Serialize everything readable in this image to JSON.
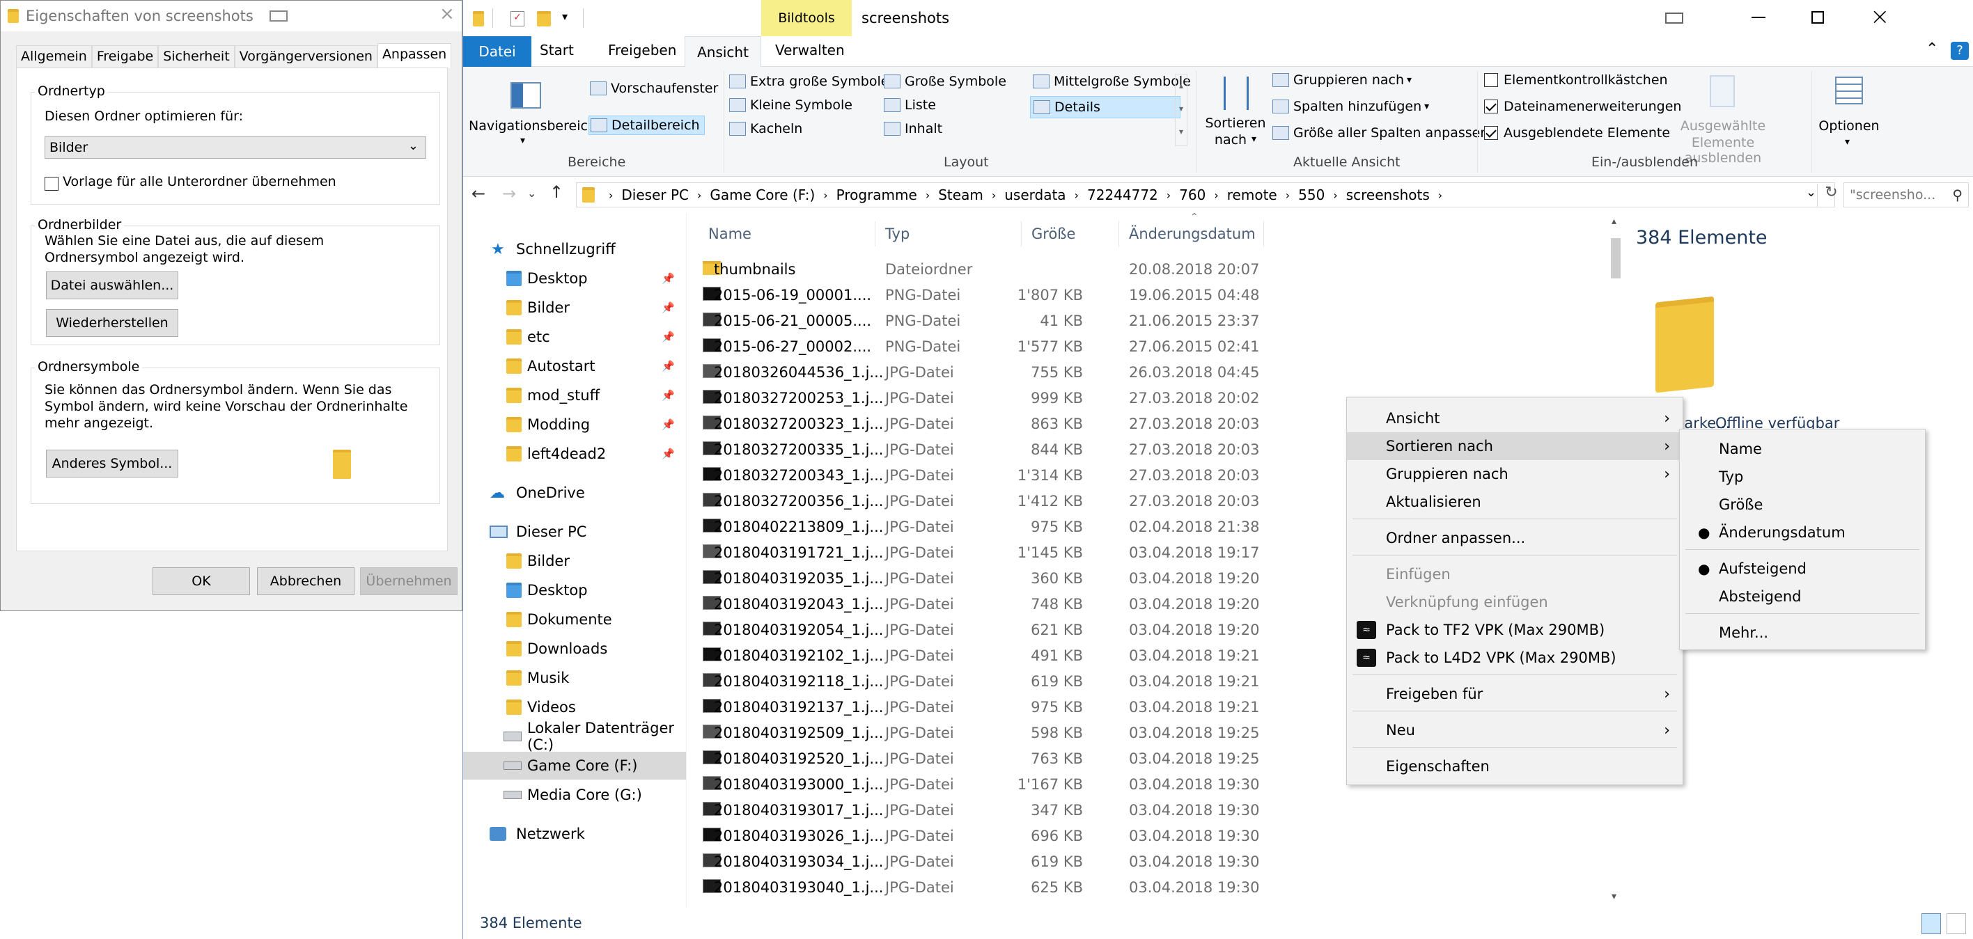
{
  "props_dialog": {
    "title": "Eigenschaften von screenshots",
    "tabs": [
      "Allgemein",
      "Freigabe",
      "Sicherheit",
      "Vorgängerversionen",
      "Anpassen"
    ],
    "ordnertyp": {
      "title": "Ordnertyp",
      "optimize_label": "Diesen Ordner optimieren für:",
      "select_value": "Bilder",
      "template_checkbox": "Vorlage für alle Unterordner übernehmen"
    },
    "ordnerbilder": {
      "title": "Ordnerbilder",
      "desc": "Wählen Sie eine Datei aus, die auf diesem Ordnersymbol angezeigt wird.",
      "choose_button": "Datei auswählen...",
      "restore_button": "Wiederherstellen"
    },
    "ordnersymbole": {
      "title": "Ordnersymbole",
      "desc": "Sie können das Ordnersymbol ändern. Wenn Sie das Symbol ändern, wird keine Vorschau der Ordnerinhalte mehr angezeigt.",
      "other_icon_button": "Anderes Symbol..."
    },
    "buttons": {
      "ok": "OK",
      "cancel": "Abbrechen",
      "apply": "Übernehmen"
    }
  },
  "explorer": {
    "context_tab_label": "Bildtools",
    "window_title": "screenshots",
    "ribbon_tabs": [
      "Datei",
      "Start",
      "Freigeben",
      "Ansicht",
      "Verwalten"
    ],
    "ribbon": {
      "bereiche": {
        "title": "Bereiche",
        "nav_pane": "Navigationsbereich",
        "preview": "Vorschaufenster",
        "details": "Detailbereich"
      },
      "layout": {
        "title": "Layout",
        "items": [
          "Extra große Symbole",
          "Große Symbole",
          "Mittelgroße Symbole",
          "Kleine Symbole",
          "Liste",
          "Details",
          "Kacheln",
          "Inhalt"
        ]
      },
      "aktuelle_ansicht": {
        "title": "Aktuelle Ansicht",
        "sort_by_line1": "Sortieren",
        "sort_by_line2": "nach",
        "group_by": "Gruppieren nach",
        "add_columns": "Spalten hinzufügen",
        "fit_columns": "Größe aller Spalten anpassen"
      },
      "ein_ausblenden": {
        "title": "Ein-/ausblenden",
        "checkbox_items": "Elementkontrollkästchen",
        "file_extensions": "Dateinamenerweiterungen",
        "hidden_items": "Ausgeblendete Elemente",
        "hide_selected_line1": "Ausgewählte",
        "hide_selected_line2": "Elemente ausblenden"
      },
      "options": "Optionen"
    },
    "breadcrumb": [
      "Dieser PC",
      "Game Core (F:)",
      "Programme",
      "Steam",
      "userdata",
      "72244772",
      "760",
      "remote",
      "550",
      "screenshots"
    ],
    "search_placeholder": "\"screensho...",
    "columns": [
      "Name",
      "Typ",
      "Größe",
      "Änderungsdatum"
    ],
    "nav": {
      "quick_access": "Schnellzugriff",
      "quick_items": [
        "Desktop",
        "Bilder",
        "etc",
        "Autostart",
        "mod_stuff",
        "Modding",
        "left4dead2"
      ],
      "onedrive": "OneDrive",
      "this_pc": "Dieser PC",
      "pc_items": [
        "Bilder",
        "Desktop",
        "Dokumente",
        "Downloads",
        "Musik",
        "Videos",
        "Lokaler Datenträger (C:)",
        "Game Core (F:)",
        "Media Core (G:)"
      ],
      "network": "Netzwerk"
    },
    "files": [
      {
        "name": "thumbnails",
        "type": "Dateiordner",
        "size": "",
        "date": "20.08.2018 20:07",
        "kind": "folder"
      },
      {
        "name": "2015-06-19_00001....",
        "type": "PNG-Datei",
        "size": "1'807 KB",
        "date": "19.06.2015 04:48",
        "kind": "img"
      },
      {
        "name": "2015-06-21_00005....",
        "type": "PNG-Datei",
        "size": "41 KB",
        "date": "21.06.2015 23:37",
        "kind": "img"
      },
      {
        "name": "2015-06-27_00002....",
        "type": "PNG-Datei",
        "size": "1'577 KB",
        "date": "27.06.2015 02:41",
        "kind": "img"
      },
      {
        "name": "20180326044536_1.j...",
        "type": "JPG-Datei",
        "size": "755 KB",
        "date": "26.03.2018 04:45",
        "kind": "img"
      },
      {
        "name": "20180327200253_1.j...",
        "type": "JPG-Datei",
        "size": "999 KB",
        "date": "27.03.2018 20:02",
        "kind": "img"
      },
      {
        "name": "20180327200323_1.j...",
        "type": "JPG-Datei",
        "size": "863 KB",
        "date": "27.03.2018 20:03",
        "kind": "img"
      },
      {
        "name": "20180327200335_1.j...",
        "type": "JPG-Datei",
        "size": "844 KB",
        "date": "27.03.2018 20:03",
        "kind": "img"
      },
      {
        "name": "20180327200343_1.j...",
        "type": "JPG-Datei",
        "size": "1'314 KB",
        "date": "27.03.2018 20:03",
        "kind": "img"
      },
      {
        "name": "20180327200356_1.j...",
        "type": "JPG-Datei",
        "size": "1'412 KB",
        "date": "27.03.2018 20:03",
        "kind": "img"
      },
      {
        "name": "20180402213809_1.j...",
        "type": "JPG-Datei",
        "size": "975 KB",
        "date": "02.04.2018 21:38",
        "kind": "img"
      },
      {
        "name": "20180403191721_1.j...",
        "type": "JPG-Datei",
        "size": "1'145 KB",
        "date": "03.04.2018 19:17",
        "kind": "img"
      },
      {
        "name": "20180403192035_1.j...",
        "type": "JPG-Datei",
        "size": "360 KB",
        "date": "03.04.2018 19:20",
        "kind": "img"
      },
      {
        "name": "20180403192043_1.j...",
        "type": "JPG-Datei",
        "size": "748 KB",
        "date": "03.04.2018 19:20",
        "kind": "img"
      },
      {
        "name": "20180403192054_1.j...",
        "type": "JPG-Datei",
        "size": "621 KB",
        "date": "03.04.2018 19:20",
        "kind": "img"
      },
      {
        "name": "20180403192102_1.j...",
        "type": "JPG-Datei",
        "size": "491 KB",
        "date": "03.04.2018 19:21",
        "kind": "img"
      },
      {
        "name": "20180403192118_1.j...",
        "type": "JPG-Datei",
        "size": "619 KB",
        "date": "03.04.2018 19:21",
        "kind": "img"
      },
      {
        "name": "20180403192137_1.j...",
        "type": "JPG-Datei",
        "size": "975 KB",
        "date": "03.04.2018 19:21",
        "kind": "img"
      },
      {
        "name": "20180403192509_1.j...",
        "type": "JPG-Datei",
        "size": "598 KB",
        "date": "03.04.2018 19:25",
        "kind": "img"
      },
      {
        "name": "20180403192520_1.j...",
        "type": "JPG-Datei",
        "size": "763 KB",
        "date": "03.04.2018 19:25",
        "kind": "img"
      },
      {
        "name": "20180403193000_1.j...",
        "type": "JPG-Datei",
        "size": "1'167 KB",
        "date": "03.04.2018 19:30",
        "kind": "img"
      },
      {
        "name": "20180403193017_1.j...",
        "type": "JPG-Datei",
        "size": "347 KB",
        "date": "03.04.2018 19:30",
        "kind": "img"
      },
      {
        "name": "20180403193026_1.j...",
        "type": "JPG-Datei",
        "size": "696 KB",
        "date": "03.04.2018 19:30",
        "kind": "img"
      },
      {
        "name": "20180403193034_1.j...",
        "type": "JPG-Datei",
        "size": "619 KB",
        "date": "03.04.2018 19:30",
        "kind": "img"
      },
      {
        "name": "20180403193040_1.j...",
        "type": "JPG-Datei",
        "size": "625 KB",
        "date": "03.04.2018 19:30",
        "kind": "img"
      }
    ],
    "details_pane": {
      "count": "384 Elemente",
      "offline_left": "...fügbarke...",
      "offline_right": "Offline verfügbar"
    },
    "status_bar": "384 Elemente"
  },
  "context_menu": {
    "items": [
      {
        "label": "Ansicht",
        "submenu": true,
        "disabled": false
      },
      {
        "label": "Sortieren nach",
        "submenu": true,
        "disabled": false
      },
      {
        "label": "Gruppieren nach",
        "submenu": true,
        "disabled": false
      },
      {
        "label": "Aktualisieren",
        "submenu": false,
        "disabled": false
      },
      {
        "label": "Ordner anpassen...",
        "submenu": false,
        "disabled": false
      },
      {
        "label": "Einfügen",
        "submenu": false,
        "disabled": true
      },
      {
        "label": "Verknüpfung einfügen",
        "submenu": false,
        "disabled": true
      },
      {
        "label": "Pack to TF2 VPK (Max 290MB)",
        "submenu": false,
        "disabled": false
      },
      {
        "label": "Pack to L4D2 VPK (Max 290MB)",
        "submenu": false,
        "disabled": false
      },
      {
        "label": "Freigeben für",
        "submenu": true,
        "disabled": false
      },
      {
        "label": "Neu",
        "submenu": true,
        "disabled": false
      },
      {
        "label": "Eigenschaften",
        "submenu": false,
        "disabled": false
      }
    ],
    "sort_submenu": {
      "fields": [
        "Name",
        "Typ",
        "Größe",
        "Änderungsdatum"
      ],
      "selected_field": "Änderungsdatum",
      "orders": [
        "Aufsteigend",
        "Absteigend"
      ],
      "selected_order": "Aufsteigend",
      "more": "Mehr..."
    }
  },
  "colors": {
    "accent": "#1979ca",
    "tools_tab": "#f7f08a",
    "selection": "#cce8ff",
    "folder": "#f3c640"
  }
}
